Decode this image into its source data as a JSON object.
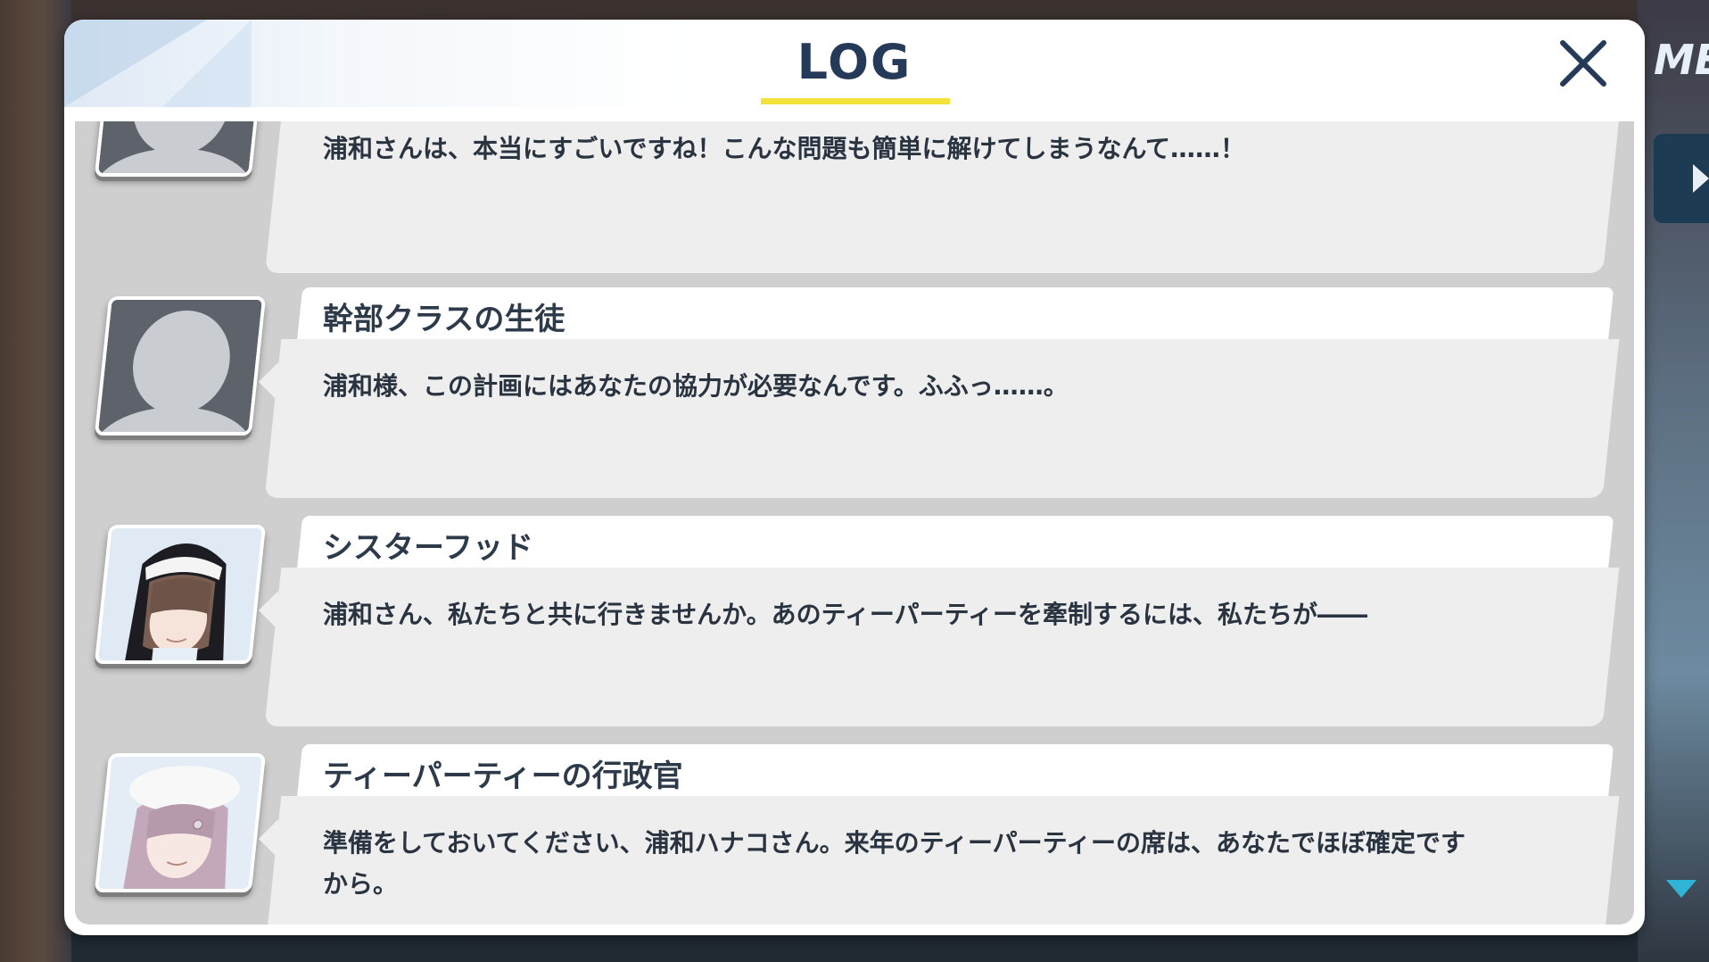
{
  "header": {
    "title": "LOG",
    "close_icon": "close-icon"
  },
  "side": {
    "menu_text": "ME"
  },
  "colors": {
    "accent": "#f2e23a",
    "title": "#243a58",
    "scroll_arrow": "#2fb4d8"
  },
  "entries": [
    {
      "speaker": "",
      "text": "浦和さんは、本当にすごいですね！こんな問題も簡単に解けてしまうなんて……！",
      "portrait": "silhouette-portrait"
    },
    {
      "speaker": "幹部クラスの生徒",
      "text": "浦和様、この計画にはあなたの協力が必要なんです。ふふっ……。",
      "portrait": "silhouette-portrait"
    },
    {
      "speaker": "シスターフッド",
      "text": "浦和さん、私たちと共に行きませんか。あのティーパーティーを牽制するには、私たちが――",
      "portrait": "nun-portrait"
    },
    {
      "speaker": "ティーパーティーの行政官",
      "text": "準備をしておいてください、浦和ハナコさん。来年のティーパーティーの席は、あなたでほぼ確定ですから。",
      "portrait": "officer-portrait"
    }
  ]
}
